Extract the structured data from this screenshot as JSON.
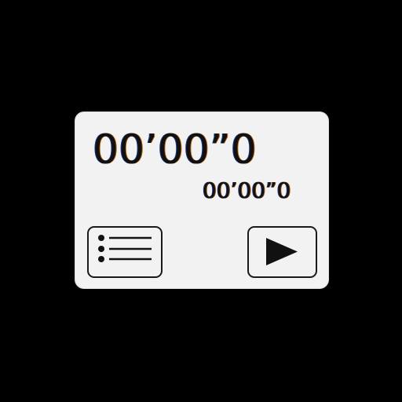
{
  "stopwatch": {
    "main_time": "00’00”0",
    "lap_time": "00’00”0"
  },
  "controls": {
    "list_icon": "list-icon",
    "play_icon": "play-icon"
  },
  "colors": {
    "background": "#000000",
    "panel": "#f2f2f2",
    "foreground": "#111111"
  }
}
